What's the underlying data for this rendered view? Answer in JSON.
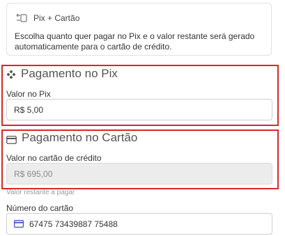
{
  "info_card": {
    "icon": "pix-transfer-icon",
    "title": "Pix + Cartão",
    "description": "Escolha quanto quer pagar no Pix e o valor restante será gerado automaticamente para o cartão de crédito."
  },
  "pix_section": {
    "icon": "pix-diamond-icon",
    "title": "Pagamento no Pix",
    "field_label": "Valor no Pix",
    "field_value": "R$ 5,00"
  },
  "card_section": {
    "icon": "credit-card-icon",
    "title": "Pagamento no Cartão",
    "credit_label": "Valor no cartão de crédito",
    "credit_value": "R$ 695,00",
    "helper_text": "Valor restante a pagar",
    "number_label": "Número do cartão",
    "number_value": "67475 73439887 75488"
  },
  "colors": {
    "highlight_frame": "#d8262c",
    "card_icon": "#3b4fc4"
  }
}
